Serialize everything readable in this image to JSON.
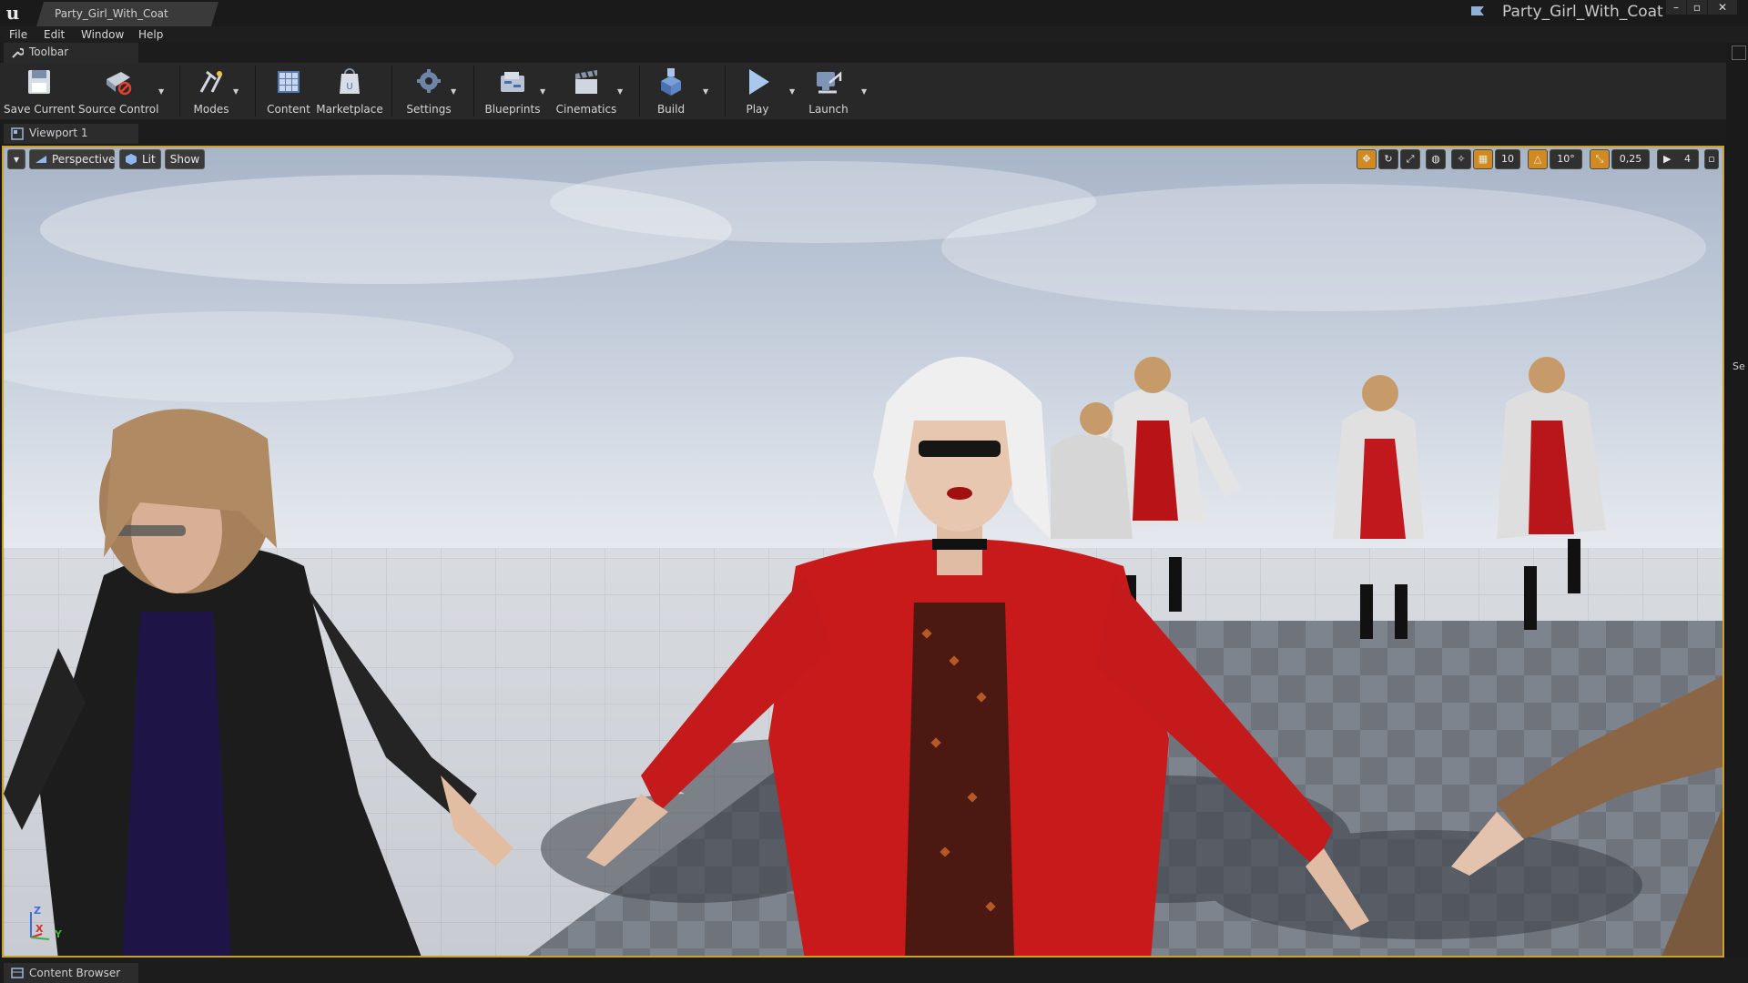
{
  "window": {
    "tab_title": "Party_Girl_With_Coat",
    "title": "Party_Girl_With_Coat",
    "controls": {
      "minimize": "–",
      "maximize": "▫",
      "close": "✕"
    }
  },
  "menu": {
    "items": [
      "File",
      "Edit",
      "Window",
      "Help"
    ]
  },
  "toolbar_tab": {
    "label": "Toolbar"
  },
  "toolbar": {
    "save": "Save Current",
    "source_control": "Source Control",
    "modes": "Modes",
    "content": "Content",
    "marketplace": "Marketplace",
    "settings": "Settings",
    "blueprints": "Blueprints",
    "cinematics": "Cinematics",
    "build": "Build",
    "play": "Play",
    "launch": "Launch"
  },
  "viewport_tab": {
    "label": "Viewport 1"
  },
  "viewport_toolbar": {
    "perspective": "Perspective",
    "lit": "Lit",
    "show": "Show",
    "grid_snap": "10",
    "rotation_snap": "10°",
    "scale_snap": "0,25",
    "camera_speed": "4"
  },
  "axes": {
    "z": "Z",
    "x": "X",
    "y": "Y"
  },
  "right_panel": {
    "label": "Se"
  },
  "content_browser_tab": {
    "label": "Content Browser"
  },
  "colors": {
    "accent": "#c9a227",
    "coat_red": "#c8191b",
    "coat_black": "#1c1c1c",
    "coat_white": "#d9d9d9"
  }
}
